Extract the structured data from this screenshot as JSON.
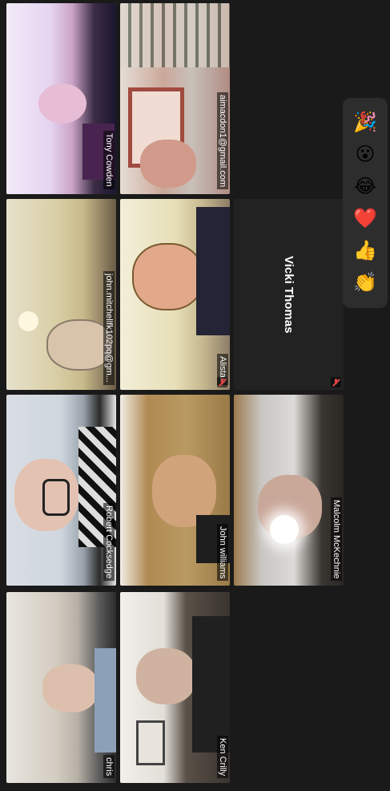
{
  "participants": [
    {
      "name": "Tony Cowden",
      "active": true
    },
    {
      "name": "aimacdon1@gmail.com"
    },
    {
      "name": "john.mitchellfk102pq@gm..."
    },
    {
      "name": "Alistair"
    },
    {
      "name": "Vicki Thomas"
    },
    {
      "name": "Robert Cocksedge"
    },
    {
      "name": "John williams"
    },
    {
      "name": "Malcolm McKechnie"
    },
    {
      "name": "chris"
    },
    {
      "name": "Ken Crilly"
    }
  ],
  "reactions": [
    {
      "name": "party-popper-icon",
      "glyph": "🎉"
    },
    {
      "name": "open-mouth-face-icon",
      "glyph": "😮"
    },
    {
      "name": "tears-of-joy-icon",
      "glyph": "😂"
    },
    {
      "name": "heart-icon",
      "glyph": "❤️"
    },
    {
      "name": "thumbs-up-icon",
      "glyph": "👍"
    },
    {
      "name": "clapping-hands-icon",
      "glyph": "👏"
    }
  ]
}
